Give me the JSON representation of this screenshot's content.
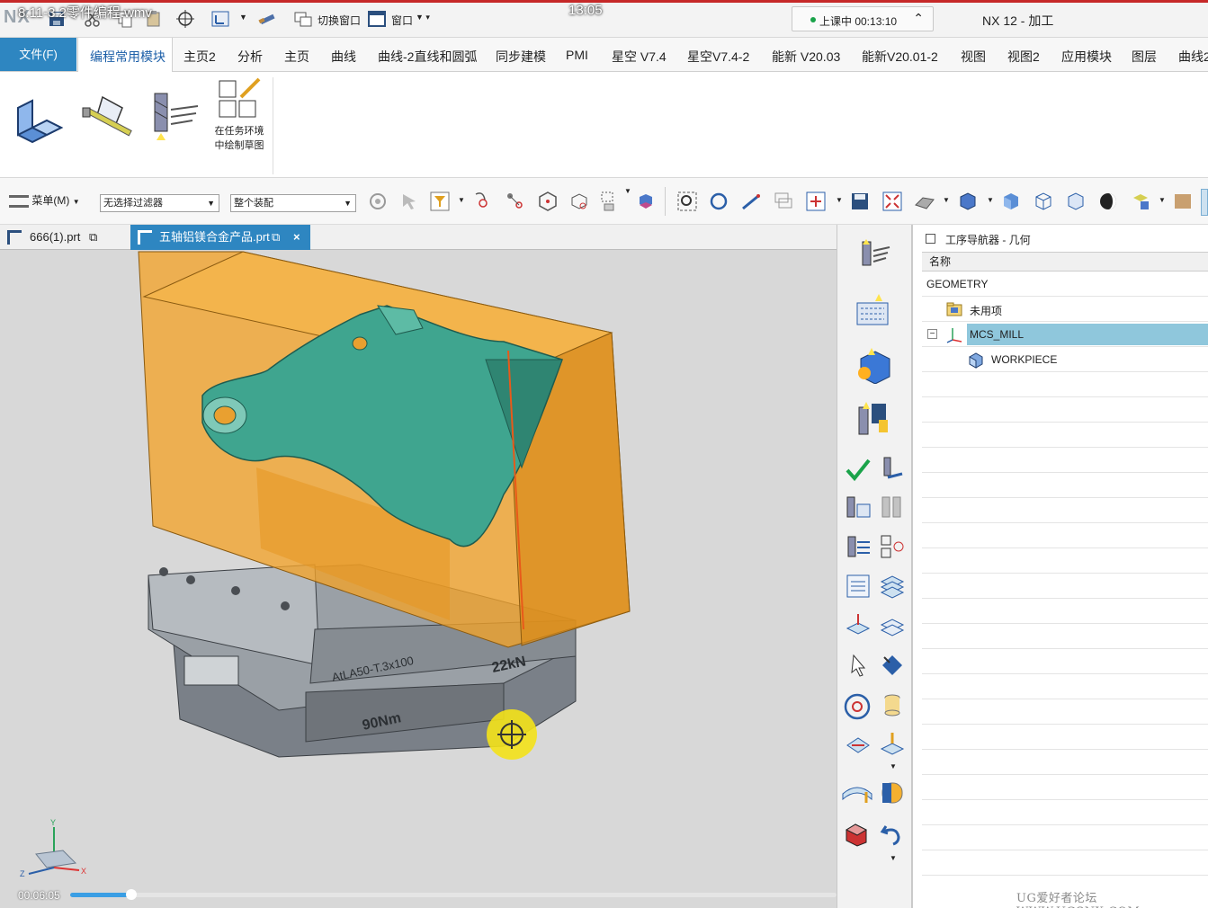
{
  "window": {
    "logo": "NX",
    "video_title": "8.11-3.2零件编程.wmv",
    "clock": "13:05",
    "app_title": "NX 12 - 加工",
    "quick_access": {
      "switch_window": "切换窗口",
      "window_menu": "窗口"
    },
    "class_status": {
      "label": "上课中 00:13:10",
      "status_color": "#1aa34a"
    }
  },
  "ribbon": {
    "file_tab": "文件(F)",
    "tabs": [
      "编程常用模块",
      "主页2",
      "分析",
      "主页",
      "曲线",
      "曲线-2直线和圆弧",
      "同步建模",
      "PMI",
      "星空 V7.4",
      "星空V7.4-2",
      "能新 V20.03",
      "能新V20.01-2",
      "视图",
      "视图2",
      "应用模块",
      "图层",
      "曲线2"
    ],
    "active_tab": "编程常用模块",
    "sketch_label_line1": "在任务环境",
    "sketch_label_line2": "中绘制草图"
  },
  "toolbar": {
    "menu_label": "菜单(M)",
    "filter_value": "无选择过滤器",
    "assembly_value": "整个装配"
  },
  "doc_tabs": [
    {
      "label": "666(1).prt",
      "active": false
    },
    {
      "label": "五轴铝镁合金产品.prt",
      "active": true
    }
  ],
  "viewport": {
    "fixture_text_1": "AtLA50-T.3x100",
    "fixture_text_2": "22kN",
    "fixture_text_3": "90Nm",
    "axis_labels": {
      "x": "X",
      "y": "Y",
      "z": "Z"
    },
    "colors": {
      "blank": "#f0a020",
      "part": "#3fa58f",
      "fixture": "#8c9298",
      "background": "#d8d8d8"
    }
  },
  "navigator": {
    "title": "工序导航器 - 几何",
    "column_name": "名称",
    "root": "GEOMETRY",
    "items": [
      {
        "label": "未用项",
        "icon": "folder-icon"
      },
      {
        "label": "MCS_MILL",
        "icon": "mcs-icon",
        "selected": true
      },
      {
        "label": "WORKPIECE",
        "icon": "workpiece-icon"
      }
    ]
  },
  "video": {
    "time": "00:06:05",
    "progress": 0.08,
    "watermark": "UG爱好者论坛 WWW.UGSNX.COM"
  }
}
